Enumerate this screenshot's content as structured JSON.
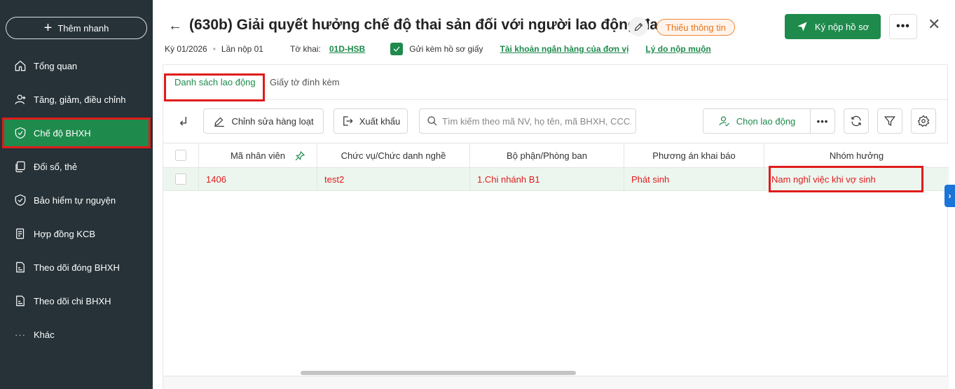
{
  "sidebar": {
    "quick_add_label": "Thêm nhanh",
    "items": [
      {
        "label": "Tổng quan",
        "icon": "home-icon"
      },
      {
        "label": "Tăng, giảm, điều chỉnh",
        "icon": "user-icon"
      },
      {
        "label": "Chế độ BHXH",
        "icon": "shield-check-icon",
        "active": true
      },
      {
        "label": "Đổi sổ, thẻ",
        "icon": "cards-icon"
      },
      {
        "label": "Bảo hiểm tự nguyện",
        "icon": "shield-icon"
      },
      {
        "label": "Hợp đồng KCB",
        "icon": "document-icon"
      },
      {
        "label": "Theo dõi đóng BHXH",
        "icon": "c12-document-icon"
      },
      {
        "label": "Theo dõi chi BHXH",
        "icon": "c8-document-icon"
      },
      {
        "label": "Khác",
        "icon": "more-dots-icon"
      }
    ]
  },
  "header": {
    "title": "(630b) Giải quyết hưởng chế độ thai sản đối với người lao động đa...",
    "badge": "Thiếu thông tin",
    "submit_label": "Ký nộp hồ sơ",
    "more_label": "•••",
    "close_label": "✕",
    "meta": {
      "period": "Kỳ 01/2026",
      "submission": "Lần nộp 01",
      "form_label": "Tờ khai:",
      "form_code": "01D-HSB",
      "send_paper_label": "Gửi kèm hồ sơ giấy",
      "bank_link": "Tài khoản ngân hàng của đơn vị",
      "late_reason_link": "Lý do nộp muộn"
    }
  },
  "tabs": [
    {
      "label": "Danh sách lao động",
      "active": true
    },
    {
      "label": "Giấy tờ đính kèm",
      "active": false
    }
  ],
  "toolbar": {
    "bulk_edit_label": "Chỉnh sửa hàng loạt",
    "export_label": "Xuất khẩu",
    "search_placeholder": "Tìm kiếm theo mã NV, họ tên, mã BHXH, CCC...",
    "choose_employee_label": "Chọn lao động",
    "more_label": "•••"
  },
  "table": {
    "headers": [
      "Mã nhân viên",
      "Chức vụ/Chức danh nghề",
      "Bộ phận/Phòng ban",
      "Phương án khai báo",
      "Nhóm hưởng"
    ],
    "rows": [
      [
        "1406",
        "test2",
        "1.Chi nhánh B1",
        "Phát sinh",
        "Nam nghỉ việc khi vợ sinh"
      ]
    ]
  },
  "colors": {
    "brand_green": "#1e8a4c",
    "sidebar_bg": "#263238",
    "highlight_red": "#e01b1b",
    "badge_orange": "#e8731c"
  }
}
